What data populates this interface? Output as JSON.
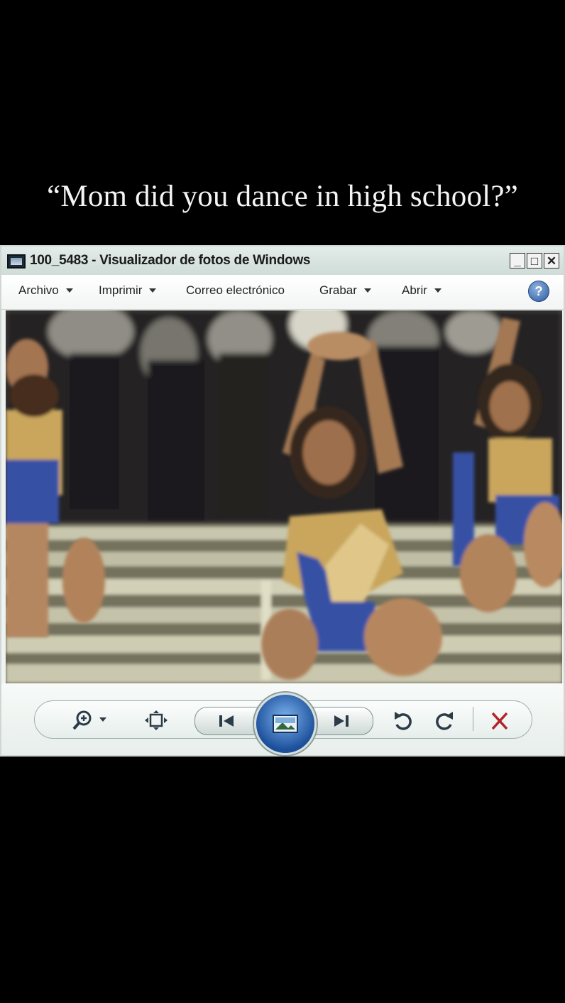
{
  "caption": "“Mom did you dance in high school?”",
  "window": {
    "title": "100_5483 - Visualizador de fotos de Windows",
    "buttons": {
      "minimize": "_",
      "maximize": "□",
      "close": "✕"
    }
  },
  "menu": {
    "items": [
      {
        "label": "Archivo",
        "has_dropdown": true
      },
      {
        "label": "Imprimir",
        "has_dropdown": true
      },
      {
        "label": "Correo electrónico",
        "has_dropdown": false
      },
      {
        "label": "Grabar",
        "has_dropdown": true
      },
      {
        "label": "Abrir",
        "has_dropdown": true
      }
    ],
    "help_label": "?"
  },
  "photo": {
    "description_icon": "photo-content",
    "colors": {
      "uniform": "#2b49a8",
      "sequins": "#c9a55a",
      "bleachers": "#bcbfa6",
      "crowd": "#141414"
    }
  },
  "controls": {
    "icons": [
      "zoom-icon",
      "fit-window-icon",
      "previous-icon",
      "slideshow-icon",
      "next-icon",
      "rotate-left-icon",
      "rotate-right-icon",
      "delete-icon"
    ],
    "delete_color": "#b2242a"
  }
}
